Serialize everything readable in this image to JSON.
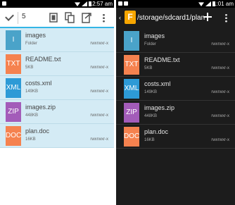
{
  "left": {
    "status_time": "12:57 am",
    "selected_count": "5",
    "files": [
      {
        "icon_text": "I",
        "name": "images",
        "detail": "Folder",
        "perm": "rwxrwxr-x",
        "color": "#4aa3c9"
      },
      {
        "icon_text": "TXT",
        "name": "README.txt",
        "detail": "5KB",
        "perm": "rwxrwxr-x",
        "color": "#f5824f"
      },
      {
        "icon_text": "XML",
        "name": "costs.xml",
        "detail": "149KB",
        "perm": "rwxrwxr-x",
        "color": "#2d9ad6"
      },
      {
        "icon_text": "ZIP",
        "name": "images.zip",
        "detail": "448KB",
        "perm": "rwxrwxr-x",
        "color": "#a35cb9"
      },
      {
        "icon_text": "DOC",
        "name": "plan.doc",
        "detail": "16KB",
        "perm": "rwxrwxr-x",
        "color": "#f5824f"
      }
    ]
  },
  "right": {
    "status_time": "1:01 am",
    "logo_letter": "F",
    "path": "/storage/sdcard1/plan",
    "files": [
      {
        "icon_text": "I",
        "name": "images",
        "detail": "Folder",
        "perm": "rwxrwxr-x",
        "color": "#4aa3c9"
      },
      {
        "icon_text": "TXT",
        "name": "README.txt",
        "detail": "5KB",
        "perm": "rwxrwxr-x",
        "color": "#f5824f"
      },
      {
        "icon_text": "XML",
        "name": "costs.xml",
        "detail": "149KB",
        "perm": "rwxrwxr-x",
        "color": "#2d9ad6"
      },
      {
        "icon_text": "ZIP",
        "name": "images.zip",
        "detail": "448KB",
        "perm": "rwxrwxr-x",
        "color": "#a35cb9"
      },
      {
        "icon_text": "DOC",
        "name": "plan.doc",
        "detail": "16KB",
        "perm": "rwxrwxr-x",
        "color": "#f5824f"
      }
    ]
  },
  "icons": [
    "check-icon",
    "copy-icon",
    "share-icon",
    "delete-icon",
    "overflow-menu-icon",
    "back-icon",
    "app-logo",
    "add-icon"
  ],
  "colors": {
    "selection_bg": "#d4ebf5",
    "accent": "#33b5e5",
    "dark_bg": "#1c1c1c",
    "logo": "#f7a600"
  }
}
